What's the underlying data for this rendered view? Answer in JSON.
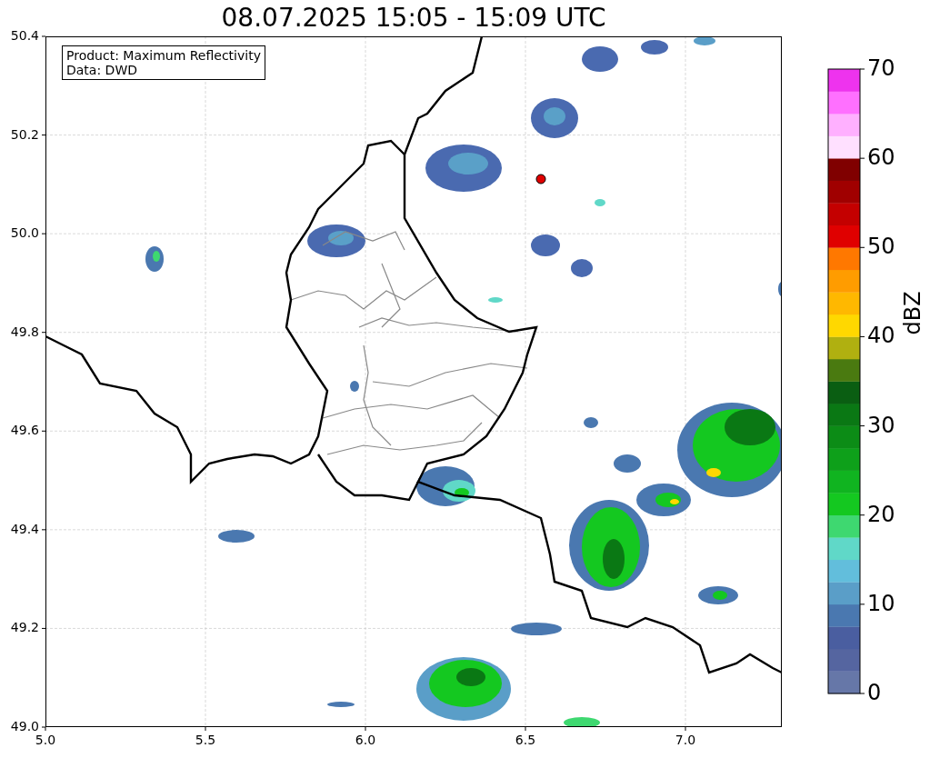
{
  "title": "08.07.2025 15:05 - 15:09 UTC",
  "map": {
    "info_box": [
      "Product: Maximum Reflectivity",
      "Data: DWD"
    ],
    "yticks": [
      "50.4",
      "50.2",
      "50.0",
      "49.8",
      "49.6",
      "49.4",
      "49.2",
      "49.0"
    ],
    "xticks": [
      "5.0",
      "5.5",
      "6.0",
      "6.5",
      "7.0"
    ]
  },
  "colorbar": {
    "label": "dBZ",
    "ticks": [
      "70",
      "60",
      "50",
      "40",
      "30",
      "20",
      "10",
      "0"
    ],
    "segments": [
      {
        "color": "#6677a8"
      },
      {
        "color": "#5565a0"
      },
      {
        "color": "#4a5ea0"
      },
      {
        "color": "#4a78b0"
      },
      {
        "color": "#5a9ec8"
      },
      {
        "color": "#62bedc"
      },
      {
        "color": "#60d8c8"
      },
      {
        "color": "#3ed870"
      },
      {
        "color": "#14c820"
      },
      {
        "color": "#10b420"
      },
      {
        "color": "#0ea01a"
      },
      {
        "color": "#0c8c16"
      },
      {
        "color": "#0a7814"
      },
      {
        "color": "#0a5e12"
      },
      {
        "color": "#4a7a10"
      },
      {
        "color": "#b0b010"
      },
      {
        "color": "#ffd800"
      },
      {
        "color": "#ffb800"
      },
      {
        "color": "#ff9c00"
      },
      {
        "color": "#ff7800"
      },
      {
        "color": "#e00000"
      },
      {
        "color": "#c40000"
      },
      {
        "color": "#a00000"
      },
      {
        "color": "#800000"
      },
      {
        "color": "#ffe0ff"
      },
      {
        "color": "#ffb0ff"
      },
      {
        "color": "#ff70ff"
      },
      {
        "color": "#ee33ee"
      }
    ]
  }
}
